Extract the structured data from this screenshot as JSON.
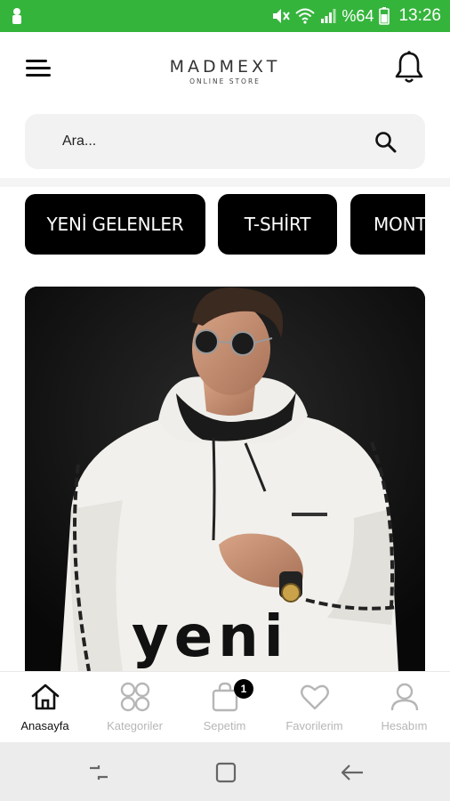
{
  "status_bar": {
    "battery_percent": "%64",
    "time": "13:26",
    "icons": [
      "person-icon",
      "mute-icon",
      "wifi-icon",
      "signal-icon",
      "battery-icon"
    ]
  },
  "header": {
    "brand": "MADMEXT",
    "tagline": "ONLINE STORE",
    "icons": [
      "menu-icon",
      "bell-icon"
    ]
  },
  "search": {
    "placeholder": "Ara...",
    "value": "",
    "icon": "search-icon"
  },
  "categories": [
    {
      "label": "YENİ GELENLER"
    },
    {
      "label": "T-SHİRT"
    },
    {
      "label": "MONT"
    }
  ],
  "banner": {
    "title": "yeni"
  },
  "bottom_nav": [
    {
      "label": "Anasayfa",
      "icon": "home-icon",
      "active": true
    },
    {
      "label": "Kategoriler",
      "icon": "grid-icon",
      "active": false
    },
    {
      "label": "Sepetim",
      "icon": "bag-icon",
      "active": false,
      "badge": "1"
    },
    {
      "label": "Favorilerim",
      "icon": "heart-icon",
      "active": false
    },
    {
      "label": "Hesabım",
      "icon": "user-icon",
      "active": false
    }
  ],
  "colors": {
    "status_bar": "#35b43c",
    "chip_bg": "#000000",
    "nav_active": "#111111",
    "nav_inactive": "#b6b6b6"
  }
}
